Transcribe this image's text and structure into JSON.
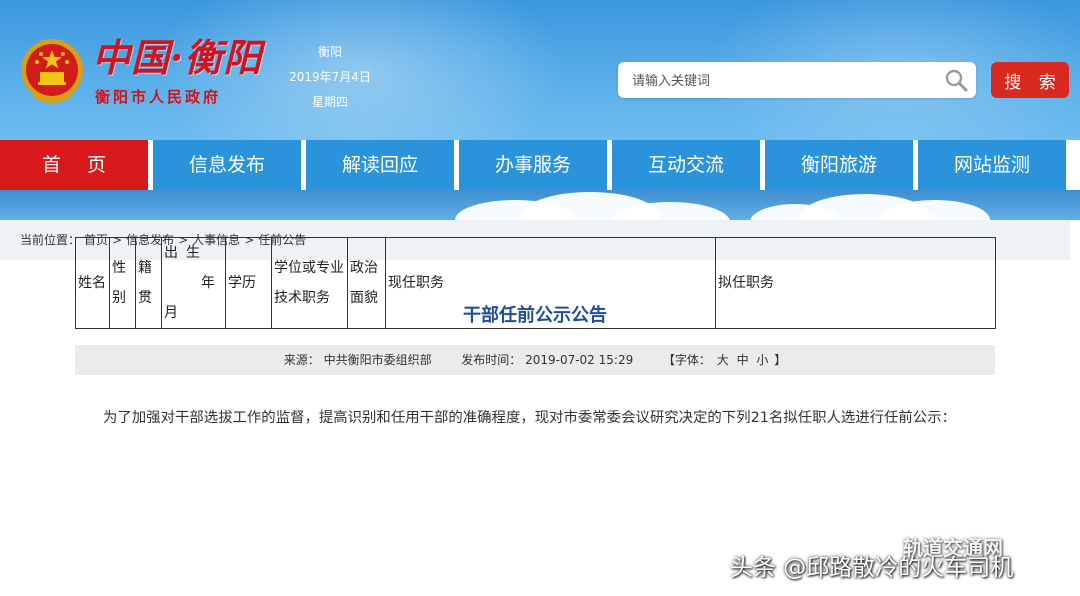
{
  "header": {
    "logo_title": "中国·衡阳",
    "logo_subtitle": "衡阳市人民政府",
    "city": "衡阳",
    "date": "2019年7月4日",
    "weekday": "星期四",
    "search_placeholder": "请输入关键词",
    "search_button": "搜 索",
    "colors": {
      "header_blue": "#3a97de",
      "accent_red": "#d9181c"
    }
  },
  "nav": {
    "items": [
      {
        "label": "首 页",
        "active": true
      },
      {
        "label": "信息发布"
      },
      {
        "label": "解读回应"
      },
      {
        "label": "办事服务"
      },
      {
        "label": "互动交流"
      },
      {
        "label": "衡阳旅游"
      },
      {
        "label": "网站监测"
      }
    ]
  },
  "breadcrumb": {
    "prefix": "当前位置：",
    "items": [
      "首页",
      "信息发布",
      "人事信息",
      "任前公告"
    ],
    "separator": ">"
  },
  "article": {
    "title": "干部任前公示公告",
    "source_label": "来源：",
    "source": "中共衡阳市委组织部",
    "publish_label": "发布时间：",
    "publish_time": "2019-07-02 15:29",
    "font_label": "【字体：",
    "font_sizes": [
      "大",
      "中",
      "小"
    ],
    "font_close": "】",
    "intro": "为了加强对干部选拔工作的监督，提高识别和任用干部的准确程度，现对市委常委会议研究决定的下列21名拟任职人选进行任前公示："
  },
  "table": {
    "headers": {
      "name": "姓名",
      "gender": "性别",
      "origin": "籍贯",
      "birth_l1": "出生",
      "birth_l2": "年",
      "birth_l3": "月",
      "education": "学历",
      "degree": "学位或专业技术职务",
      "political": "政治面貌",
      "current": "现任职务",
      "proposed": "拟任职务"
    }
  },
  "watermark": {
    "logo": "轨道交通网",
    "author": "头条 @邱路散冷的火车司机"
  },
  "icons": {
    "search": "search-icon",
    "emblem": "national-emblem-icon",
    "watermark": "wechat-icon"
  }
}
